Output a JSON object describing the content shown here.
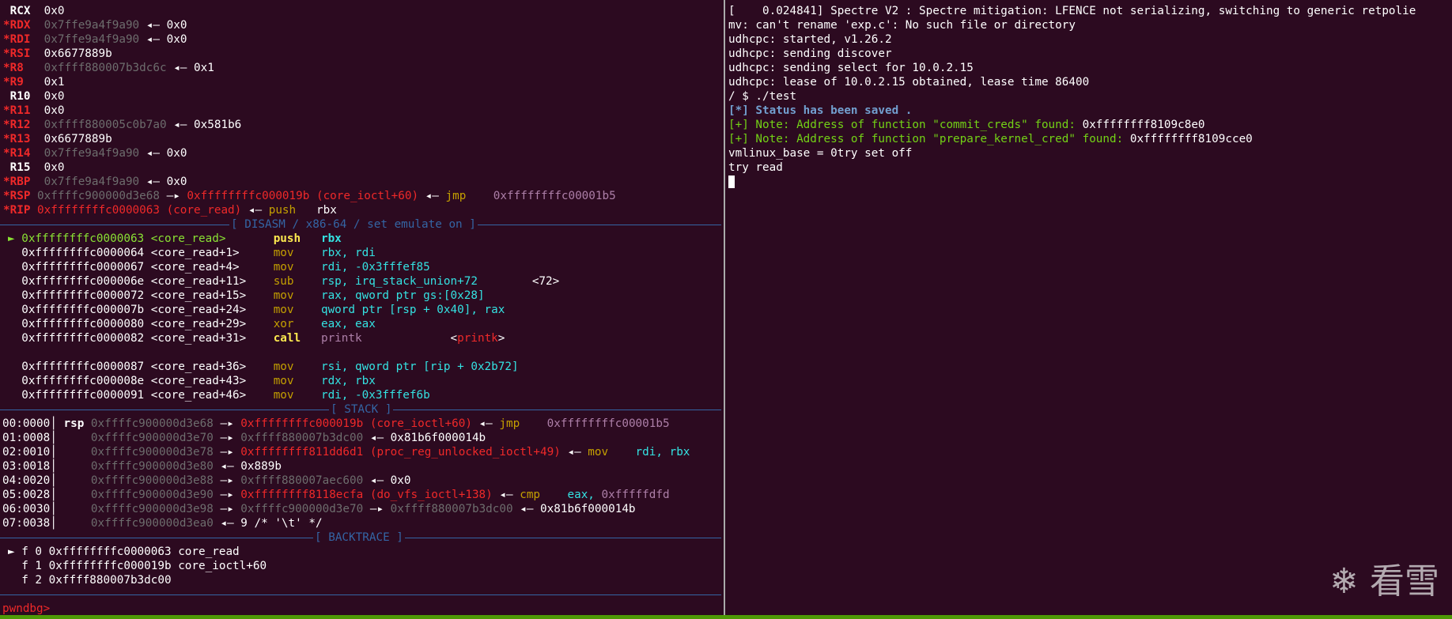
{
  "registers": [
    {
      "mod": "",
      "name": "RCX",
      "val": "0x0",
      "ptr": ""
    },
    {
      "mod": "*",
      "name": "RDX",
      "val": "0x7ffe9a4f9a90",
      "ptr": "0x0"
    },
    {
      "mod": "*",
      "name": "RDI",
      "val": "0x7ffe9a4f9a90",
      "ptr": "0x0"
    },
    {
      "mod": "*",
      "name": "RSI",
      "val": "0x6677889b",
      "ptr": ""
    },
    {
      "mod": "*",
      "name": "R8",
      "val": "0xffff880007b3dc6c",
      "ptr": "0x1"
    },
    {
      "mod": "*",
      "name": "R9",
      "val": "0x1",
      "ptr": ""
    },
    {
      "mod": "",
      "name": "R10",
      "val": "0x0",
      "ptr": ""
    },
    {
      "mod": "*",
      "name": "R11",
      "val": "0x0",
      "ptr": ""
    },
    {
      "mod": "*",
      "name": "R12",
      "val": "0xffff880005c0b7a0",
      "ptr": "0x581b6"
    },
    {
      "mod": "*",
      "name": "R13",
      "val": "0x6677889b",
      "ptr": ""
    },
    {
      "mod": "*",
      "name": "R14",
      "val": "0x7ffe9a4f9a90",
      "ptr": "0x0"
    },
    {
      "mod": "",
      "name": "R15",
      "val": "0x0",
      "ptr": ""
    },
    {
      "mod": "*",
      "name": "RBP",
      "val": "0x7ffe9a4f9a90",
      "ptr": "0x0"
    }
  ],
  "rsp": {
    "name": "*RSP",
    "val": "0xffffc900000d3e68",
    "arrow": "—▸",
    "target": "0xffffffffc000019b (core_ioctl+60)",
    "back": "◂—",
    "op": "jmp",
    "arg": "0xffffffffc00001b5"
  },
  "rip": {
    "name": "*RIP",
    "val": "0xffffffffc0000063 (core_read)",
    "back": "◂—",
    "op": "push",
    "arg": "rbx"
  },
  "sections": {
    "disasm": "[ DISASM / x86-64 / set emulate on ]",
    "stack": "[ STACK ]",
    "backtrace": "[ BACKTRACE ]"
  },
  "disasm": [
    {
      "cur": true,
      "addr": "0xffffffffc0000063",
      "sym": "<core_read>",
      "op": "push",
      "args": [
        {
          "t": "rbx",
          "c": "cyan"
        }
      ]
    },
    {
      "cur": false,
      "addr": "0xffffffffc0000064",
      "sym": "<core_read+1>",
      "op": "mov",
      "args": [
        {
          "t": "rbx, rdi",
          "c": "cyan"
        }
      ]
    },
    {
      "cur": false,
      "addr": "0xffffffffc0000067",
      "sym": "<core_read+4>",
      "op": "mov",
      "args": [
        {
          "t": "rdi, -0x3fffef85",
          "c": "cyan"
        }
      ]
    },
    {
      "cur": false,
      "addr": "0xffffffffc000006e",
      "sym": "<core_read+11>",
      "op": "sub",
      "args": [
        {
          "t": "rsp, irq_stack_union+72",
          "c": "cyan"
        },
        {
          "t": "        <72>",
          "c": "white"
        }
      ]
    },
    {
      "cur": false,
      "addr": "0xffffffffc0000072",
      "sym": "<core_read+15>",
      "op": "mov",
      "args": [
        {
          "t": "rax, qword ptr gs:[0x28]",
          "c": "cyan"
        }
      ]
    },
    {
      "cur": false,
      "addr": "0xffffffffc000007b",
      "sym": "<core_read+24>",
      "op": "mov",
      "args": [
        {
          "t": "qword ptr [rsp + 0x40], rax",
          "c": "cyan"
        }
      ]
    },
    {
      "cur": false,
      "addr": "0xffffffffc0000080",
      "sym": "<core_read+29>",
      "op": "xor",
      "args": [
        {
          "t": "eax, eax",
          "c": "cyan"
        }
      ]
    },
    {
      "cur": false,
      "addr": "0xffffffffc0000082",
      "sym": "<core_read+31>",
      "op": "call",
      "args": [
        {
          "t": "printk",
          "c": "purple"
        },
        {
          "t": "             <",
          "c": "white"
        },
        {
          "t": "printk",
          "c": "red"
        },
        {
          "t": ">",
          "c": "white"
        }
      ]
    },
    {
      "cur": false,
      "addr": "",
      "sym": "",
      "op": "",
      "args": []
    },
    {
      "cur": false,
      "addr": "0xffffffffc0000087",
      "sym": "<core_read+36>",
      "op": "mov",
      "args": [
        {
          "t": "rsi, qword ptr [rip + 0x2b72]",
          "c": "cyan"
        }
      ]
    },
    {
      "cur": false,
      "addr": "0xffffffffc000008e",
      "sym": "<core_read+43>",
      "op": "mov",
      "args": [
        {
          "t": "rdx, rbx",
          "c": "cyan"
        }
      ]
    },
    {
      "cur": false,
      "addr": "0xffffffffc0000091",
      "sym": "<core_read+46>",
      "op": "mov",
      "args": [
        {
          "t": "rdi, -0x3fffef6b",
          "c": "cyan"
        }
      ]
    }
  ],
  "stack": [
    {
      "off": "00:0000",
      "reg": "rsp",
      "addr": "0xffffc900000d3e68",
      "chain": [
        {
          "t": " —▸ ",
          "c": "white"
        },
        {
          "t": "0xffffffffc000019b (core_ioctl+60)",
          "c": "red"
        },
        {
          "t": " ◂— ",
          "c": "white"
        },
        {
          "t": "jmp",
          "c": "yellow"
        },
        {
          "t": "    0xffffffffc00001b5",
          "c": "purple"
        }
      ]
    },
    {
      "off": "01:0008",
      "reg": "",
      "addr": "0xffffc900000d3e70",
      "chain": [
        {
          "t": " —▸ ",
          "c": "white"
        },
        {
          "t": "0xffff880007b3dc00",
          "c": "gray"
        },
        {
          "t": " ◂— 0x81b6f000014b",
          "c": "white"
        }
      ]
    },
    {
      "off": "02:0010",
      "reg": "",
      "addr": "0xffffc900000d3e78",
      "chain": [
        {
          "t": " —▸ ",
          "c": "white"
        },
        {
          "t": "0xffffffff811dd6d1 (proc_reg_unlocked_ioctl+49)",
          "c": "red"
        },
        {
          "t": " ◂— ",
          "c": "white"
        },
        {
          "t": "mov",
          "c": "yellow"
        },
        {
          "t": "    rdi, rbx",
          "c": "cyan"
        }
      ]
    },
    {
      "off": "03:0018",
      "reg": "",
      "addr": "0xffffc900000d3e80",
      "chain": [
        {
          "t": " ◂— 0x889b",
          "c": "white"
        }
      ]
    },
    {
      "off": "04:0020",
      "reg": "",
      "addr": "0xffffc900000d3e88",
      "chain": [
        {
          "t": " —▸ ",
          "c": "white"
        },
        {
          "t": "0xffff880007aec600",
          "c": "gray"
        },
        {
          "t": " ◂— 0x0",
          "c": "white"
        }
      ]
    },
    {
      "off": "05:0028",
      "reg": "",
      "addr": "0xffffc900000d3e90",
      "chain": [
        {
          "t": " —▸ ",
          "c": "white"
        },
        {
          "t": "0xffffffff8118ecfa (do_vfs_ioctl+138)",
          "c": "red"
        },
        {
          "t": " ◂— ",
          "c": "white"
        },
        {
          "t": "cmp",
          "c": "yellow"
        },
        {
          "t": "    eax, ",
          "c": "cyan"
        },
        {
          "t": "0xfffffdfd",
          "c": "purple"
        }
      ]
    },
    {
      "off": "06:0030",
      "reg": "",
      "addr": "0xffffc900000d3e98",
      "chain": [
        {
          "t": " —▸ ",
          "c": "white"
        },
        {
          "t": "0xffffc900000d3e70",
          "c": "gray"
        },
        {
          "t": " —▸ ",
          "c": "white"
        },
        {
          "t": "0xffff880007b3dc00",
          "c": "gray"
        },
        {
          "t": " ◂— 0x81b6f000014b",
          "c": "white"
        }
      ]
    },
    {
      "off": "07:0038",
      "reg": "",
      "addr": "0xffffc900000d3ea0",
      "chain": [
        {
          "t": " ◂— 9 /* '\\t' */",
          "c": "white"
        }
      ]
    }
  ],
  "backtrace": [
    {
      "cur": true,
      "text": "f 0 0xffffffffc0000063 core_read"
    },
    {
      "cur": false,
      "text": "f 1 0xffffffffc000019b core_ioctl+60"
    },
    {
      "cur": false,
      "text": "f 2 0xffff880007b3dc00"
    }
  ],
  "prompt": "pwndbg>",
  "console": [
    [
      {
        "t": "[    0.024841] Spectre V2 : Spectre mitigation: LFENCE not serializing, switching to generic retpolie",
        "c": "white"
      }
    ],
    [
      {
        "t": "mv: can't rename 'exp.c': No such file or directory",
        "c": "white"
      }
    ],
    [
      {
        "t": "udhcpc: started, v1.26.2",
        "c": "white"
      }
    ],
    [
      {
        "t": "udhcpc: sending discover",
        "c": "white"
      }
    ],
    [
      {
        "t": "udhcpc: sending select for 10.0.2.15",
        "c": "white"
      }
    ],
    [
      {
        "t": "udhcpc: lease of 10.0.2.15 obtained, lease time 86400",
        "c": "white"
      }
    ],
    [
      {
        "t": "/ $ ./test",
        "c": "white"
      }
    ],
    [
      {
        "t": "[*] Status has been saved .",
        "c": "blueb"
      }
    ],
    [
      {
        "t": "[+] Note: Address of function \"commit_creds\" found: ",
        "c": "note"
      },
      {
        "t": "0xffffffff8109c8e0",
        "c": "white"
      }
    ],
    [
      {
        "t": "[+] Note: Address of function \"prepare_kernel_cred\" found: ",
        "c": "note"
      },
      {
        "t": "0xffffffff8109cce0",
        "c": "white"
      }
    ],
    [
      {
        "t": "vmlinux_base = 0try set off",
        "c": "white"
      }
    ],
    [
      {
        "t": "try read",
        "c": "white"
      }
    ]
  ],
  "watermark": "❄ 看雪",
  "colors": {
    "bg": "#2c0a20",
    "red": "#ef2929",
    "yellow": "#c4a000",
    "purple": "#ad7fa8",
    "cyan": "#34e2e2",
    "blue": "#3465a4",
    "green": "#73d216"
  }
}
